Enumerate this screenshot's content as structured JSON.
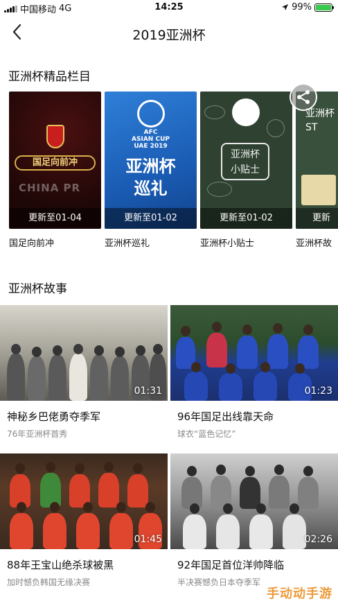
{
  "status_bar": {
    "carrier": "中国移动",
    "network": "4G",
    "time": "14:25",
    "battery": "99%",
    "battery_level": 0.99,
    "battery_color": "#3cc94f"
  },
  "nav": {
    "title": "2019亚洲杯",
    "back_icon": "chevron-left-icon"
  },
  "columns_section": {
    "title": "亚洲杯精品栏目",
    "items": [
      {
        "name": "国足向前冲",
        "update": "更新至01-04",
        "cover_text": "国足向前冲",
        "cover_sub": "CHINA PR"
      },
      {
        "name": "亚洲杯巡礼",
        "update": "更新至01-02",
        "cover_text_1": "亚洲杯",
        "cover_text_2": "巡礼",
        "logo_text_1": "AFC",
        "logo_text_2": "ASIAN CUP",
        "logo_text_3": "UAE 2019"
      },
      {
        "name": "亚洲杯小贴士",
        "update": "更新至01-02",
        "cover_text_1": "亚洲杯",
        "cover_text_2": "小贴士"
      },
      {
        "name": "亚洲杯故",
        "update": "更新",
        "cover_text_1": "亚洲杯",
        "cover_text_2": "ST"
      }
    ],
    "share_icon": "share-icon"
  },
  "stories_section": {
    "title": "亚洲杯故事",
    "items": [
      {
        "title": "神秘乡巴佬勇夺季军",
        "subtitle": "76年亚洲杯首秀",
        "duration": "01:31"
      },
      {
        "title": "96年国足出线靠天命",
        "subtitle": "球衣“蓝色记忆”",
        "duration": "01:23"
      },
      {
        "title": "88年王宝山绝杀球被黑",
        "subtitle": "加时憾负韩国无缘决赛",
        "duration": "01:45"
      },
      {
        "title": "92年国足首位洋帅降临",
        "subtitle": "半决赛憾负日本夺季军",
        "duration": "02:26"
      }
    ]
  },
  "watermark": "手动动手游"
}
